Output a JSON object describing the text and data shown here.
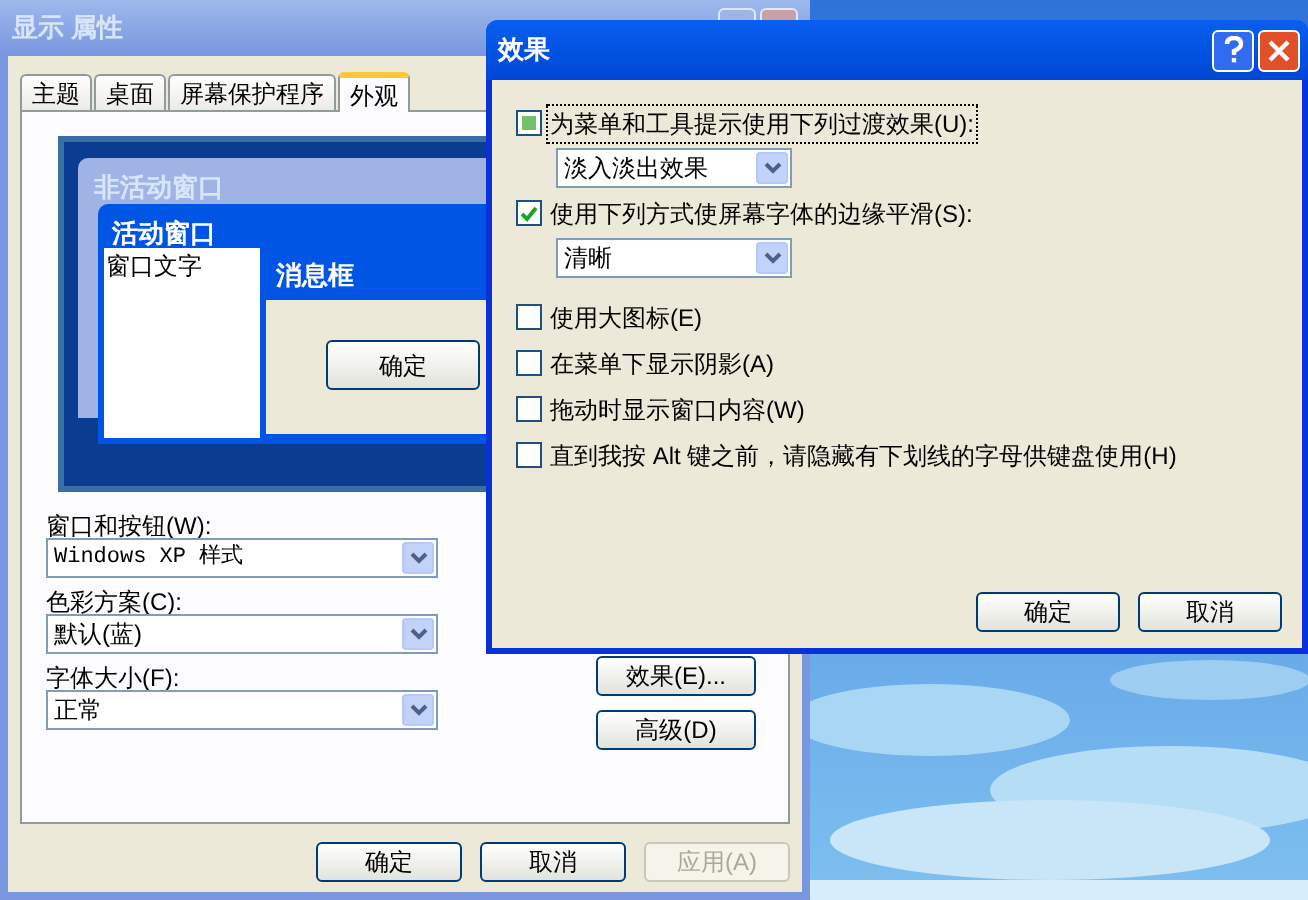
{
  "display_properties": {
    "title": "显示 属性",
    "tabs": [
      {
        "label": "主题",
        "selected": false
      },
      {
        "label": "桌面",
        "selected": false
      },
      {
        "label": "屏幕保护程序",
        "selected": false
      },
      {
        "label": "外观",
        "selected": true
      }
    ],
    "preview": {
      "inactive_window_title": "非活动窗口",
      "active_window_title": "活动窗口",
      "window_text": "窗口文字",
      "message_box_title": "消息框",
      "message_box_button": "确定"
    },
    "fields": [
      {
        "label": "窗口和按钮(W):",
        "value": "Windows XP 样式"
      },
      {
        "label": "色彩方案(C):",
        "value": "默认(蓝)"
      },
      {
        "label": "字体大小(F):",
        "value": "正常"
      }
    ],
    "side_buttons": [
      "效果(E)...",
      "高级(D)"
    ],
    "buttons": [
      {
        "label": "确定",
        "disabled": false
      },
      {
        "label": "取消",
        "disabled": false
      },
      {
        "label": "应用(A)",
        "disabled": true
      }
    ]
  },
  "effects_dialog": {
    "title": "效果",
    "options": [
      {
        "kind": "checkbox",
        "label": "为菜单和工具提示使用下列过渡效果(U):",
        "checked": true,
        "indeterminate": true,
        "focused": true
      },
      {
        "kind": "dropdown",
        "value": "淡入淡出效果"
      },
      {
        "kind": "checkbox",
        "label": "使用下列方式使屏幕字体的边缘平滑(S):",
        "checked": true,
        "indeterminate": false,
        "focused": false
      },
      {
        "kind": "dropdown",
        "value": "清晰"
      },
      {
        "kind": "checkbox",
        "label": "使用大图标(E)",
        "checked": false,
        "indeterminate": false,
        "focused": false
      },
      {
        "kind": "checkbox",
        "label": "在菜单下显示阴影(A)",
        "checked": false,
        "indeterminate": false,
        "focused": false
      },
      {
        "kind": "checkbox",
        "label": "拖动时显示窗口内容(W)",
        "checked": false,
        "indeterminate": false,
        "focused": false
      },
      {
        "kind": "checkbox",
        "label": "直到我按 Alt 键之前，请隐藏有下划线的字母供键盘使用(H)",
        "checked": false,
        "indeterminate": false,
        "focused": false
      }
    ],
    "buttons": [
      "确定",
      "取消"
    ]
  }
}
